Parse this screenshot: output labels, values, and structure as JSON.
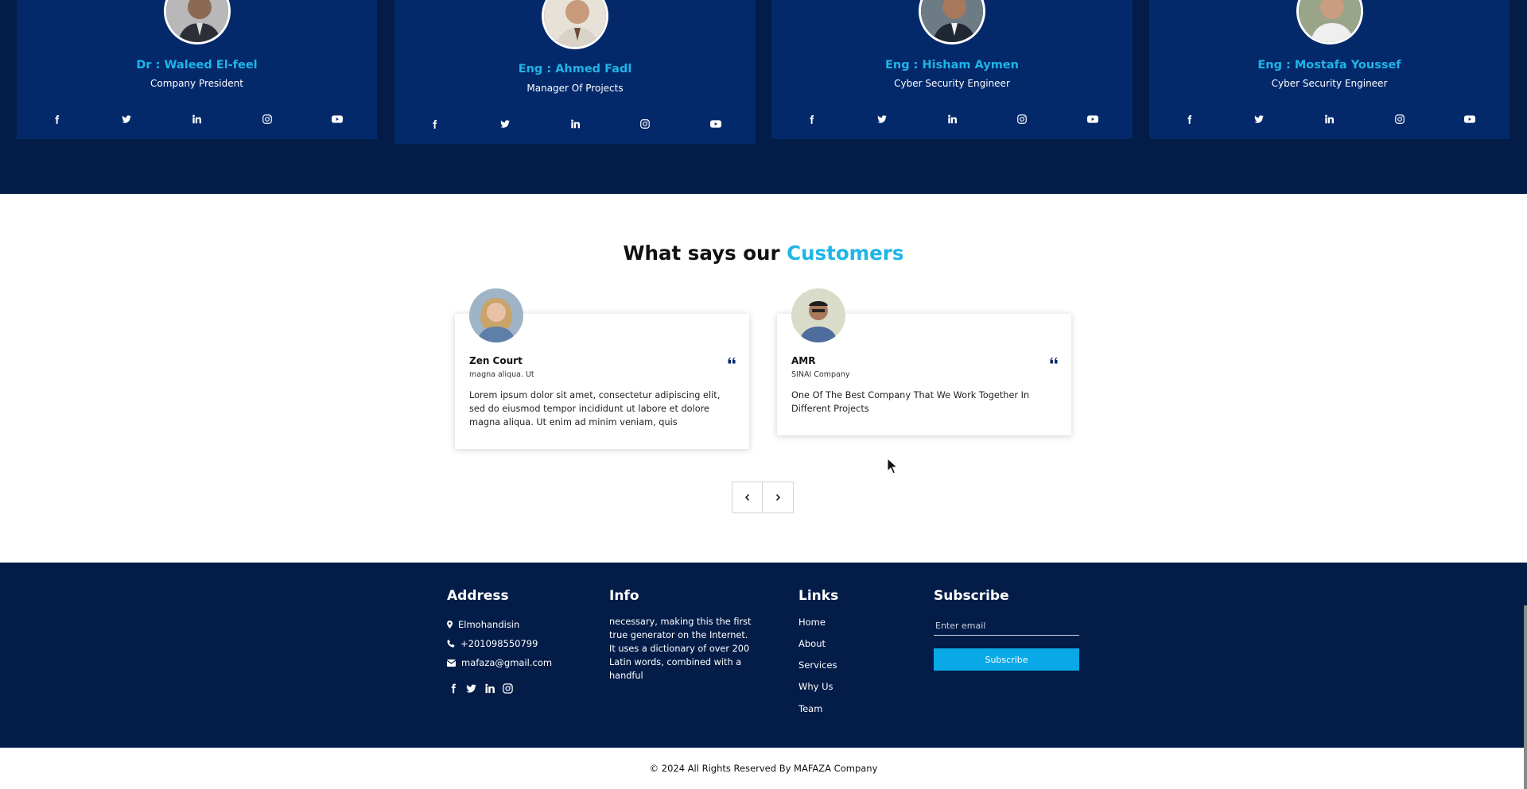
{
  "team": {
    "members": [
      {
        "name": "Dr : Waleed El-feel",
        "role": "Company President"
      },
      {
        "name": "Eng : Ahmed Fadl",
        "role": "Manager Of Projects"
      },
      {
        "name": "Eng : Hisham Aymen",
        "role": "Cyber Security Engineer"
      },
      {
        "name": "Eng : Mostafa Youssef",
        "role": "Cyber Security Engineer"
      }
    ],
    "social_icons": [
      "facebook-icon",
      "twitter-icon",
      "linkedin-icon",
      "instagram-icon",
      "youtube-icon"
    ]
  },
  "testimonials": {
    "title_prefix": "What says our",
    "title_accent": "Customers",
    "items": [
      {
        "name": "Zen Court",
        "subtitle": "magna aliqua. Ut",
        "text": "Lorem ipsum dolor sit amet, consectetur adipiscing elit, sed do eiusmod tempor incididunt ut labore et dolore magna aliqua. Ut enim ad minim veniam, quis"
      },
      {
        "name": "AMR",
        "subtitle": "SINAI Company",
        "text": "One Of The Best Company That We Work Together In Different Projects"
      }
    ],
    "prev_icon": "chevron-left-icon",
    "next_icon": "chevron-right-icon"
  },
  "footer": {
    "address": {
      "heading": "Address",
      "location": "Elmohandisin",
      "phone": "+201098550799",
      "email": "mafaza@gmail.com"
    },
    "info": {
      "heading": "Info",
      "text": "necessary, making this the first true generator on the Internet. It uses a dictionary of over 200 Latin words, combined with a handful"
    },
    "links": {
      "heading": "Links",
      "items": [
        "Home",
        "About",
        "Services",
        "Why Us",
        "Team"
      ]
    },
    "subscribe": {
      "heading": "Subscribe",
      "placeholder": "Enter email",
      "button": "Subscribe"
    }
  },
  "copyright": "© 2024 All Rights Reserved By MAFAZA Company",
  "colors": {
    "navy_dark": "#031d48",
    "navy_card": "#03296b",
    "accent": "#1fb5e6",
    "button": "#0aa8e6"
  }
}
